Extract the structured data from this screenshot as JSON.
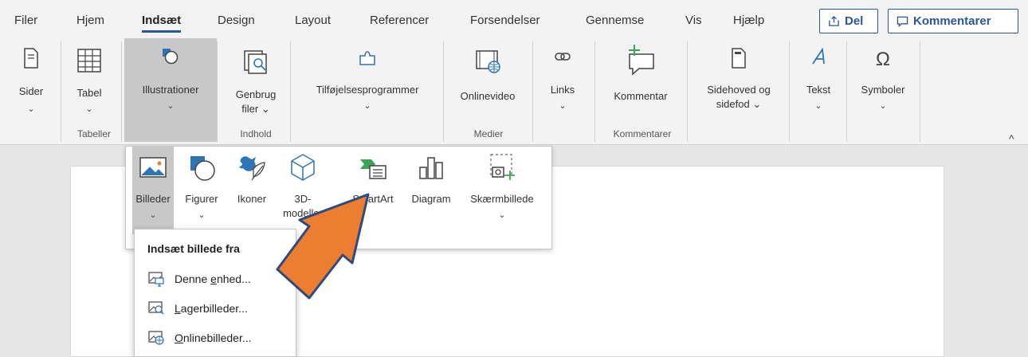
{
  "menu": {
    "tabs": [
      "Filer",
      "Hjem",
      "Indsæt",
      "Design",
      "Layout",
      "Referencer",
      "Forsendelser",
      "Gennemse",
      "Vis",
      "Hjælp"
    ],
    "active_tab": "Indsæt",
    "share_label": "Del",
    "comments_label": "Kommentarer"
  },
  "ribbon": {
    "sider": "Sider",
    "tabel": "Tabel",
    "illustrationer": "Illustrationer",
    "genbrug_line1": "Genbrug",
    "genbrug_line2": "filer",
    "tilfoejelser": "Tilføjelsesprogrammer",
    "onlinevideo": "Onlinevideo",
    "links": "Links",
    "kommentar": "Kommentar",
    "sidehoved_line1": "Sidehoved og",
    "sidehoved_line2": "sidefod",
    "tekst": "Tekst",
    "symboler": "Symboler",
    "groups": {
      "tabeller": "Tabeller",
      "indhold": "Indhold",
      "medier": "Medier",
      "kommentarer": "Kommentarer"
    }
  },
  "illustrations": {
    "billeder": "Billeder",
    "figurer": "Figurer",
    "ikoner": "Ikoner",
    "modeller_line1": "3D-",
    "modeller_line2": "modeller",
    "smartart": "SmartArt",
    "diagram": "Diagram",
    "skaermbillede": "Skærmbillede",
    "group_label": "Illustrationer"
  },
  "picture_menu": {
    "title": "Indsæt billede fra",
    "items": [
      {
        "pre": "Denne ",
        "key": "e",
        "post": "nhed..."
      },
      {
        "pre": "",
        "key": "L",
        "post": "agerbilleder..."
      },
      {
        "pre": "",
        "key": "O",
        "post": "nlinebilleder..."
      }
    ]
  },
  "colors": {
    "accent": "#2b579a",
    "arrow_fill": "#ed7d31",
    "arrow_stroke": "#2f4b7c",
    "icon_blue": "#2e75b6",
    "icon_green": "#3aa655"
  }
}
